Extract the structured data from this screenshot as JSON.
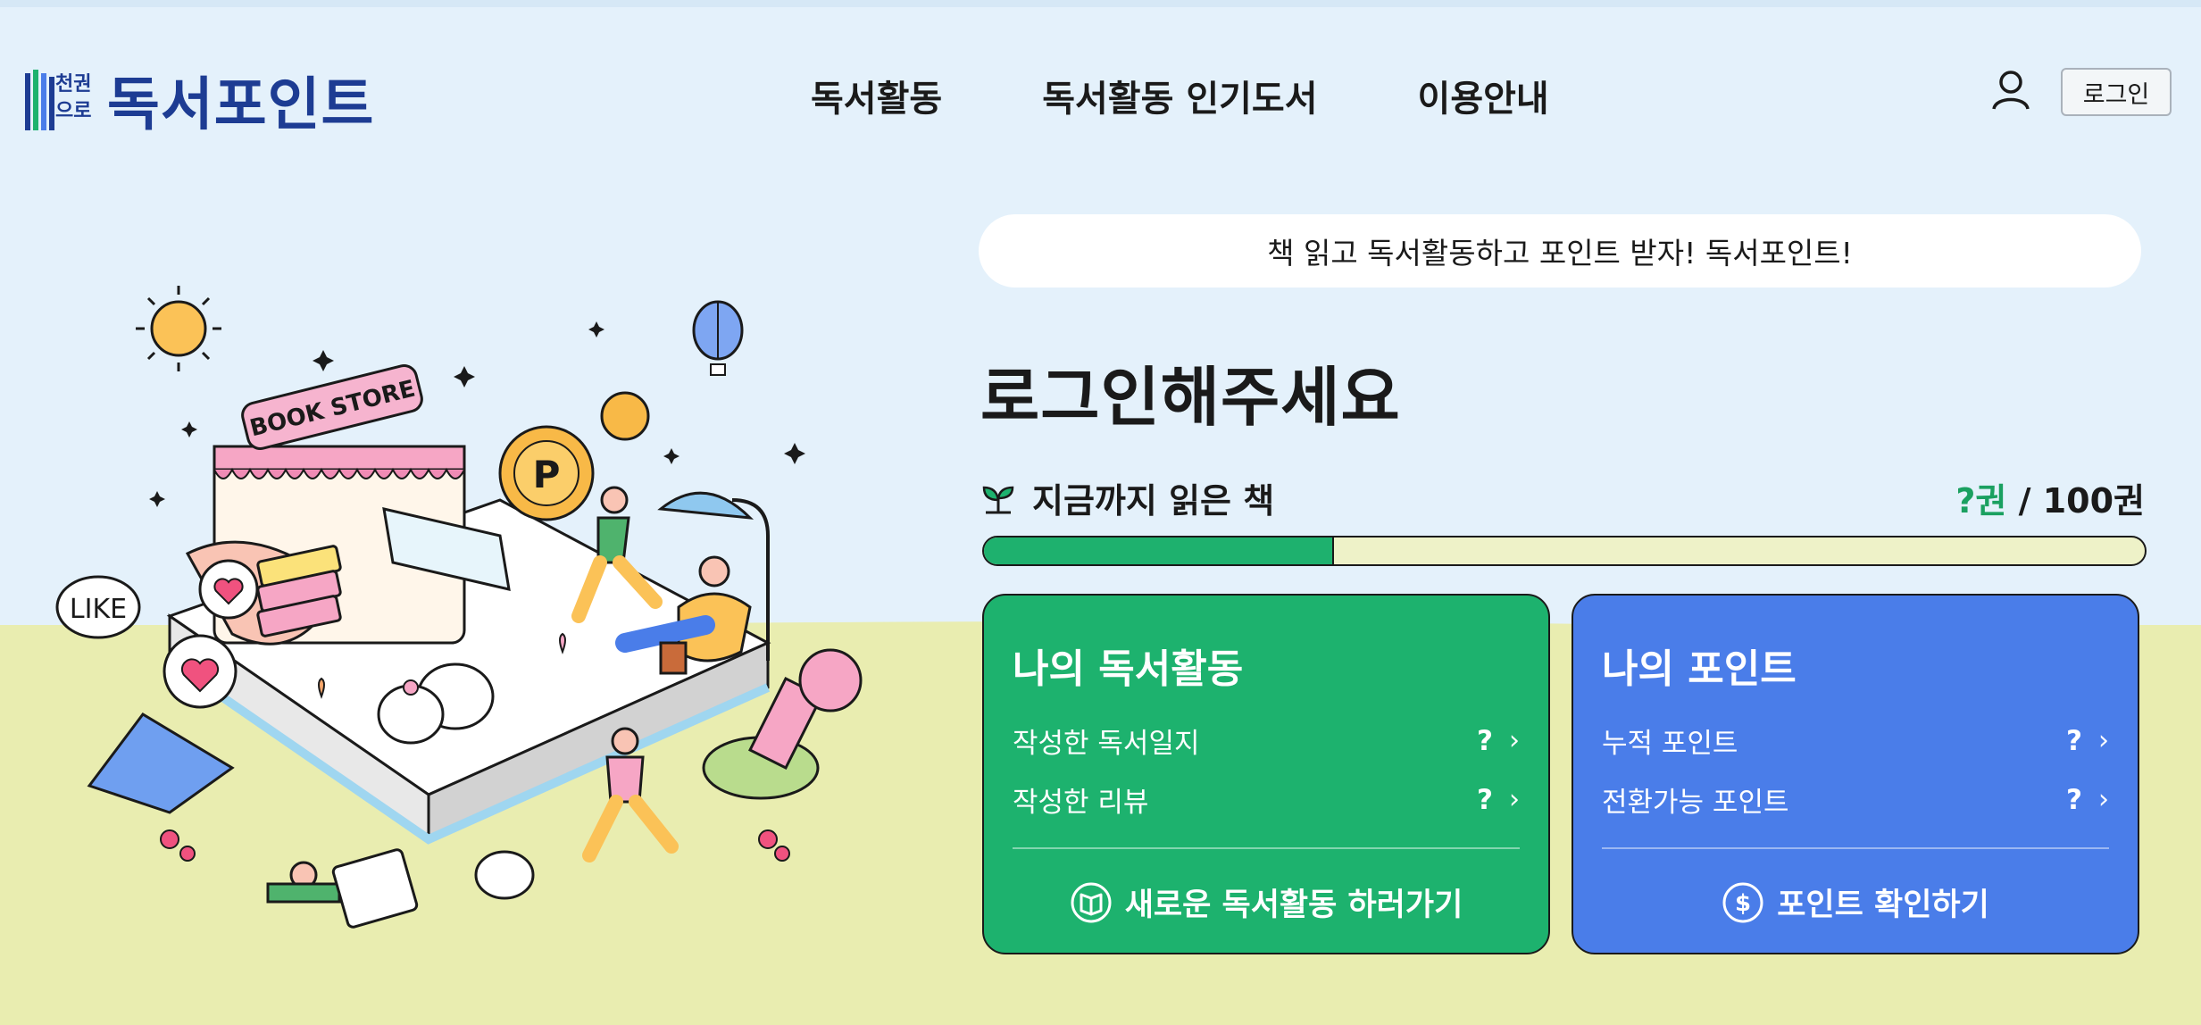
{
  "header": {
    "logo_small": "천권으로",
    "logo_text": "독서포인트",
    "nav": [
      "독서활동",
      "독서활동 인기도서",
      "이용안내"
    ],
    "login_label": "로그인",
    "user_icon": "user-icon"
  },
  "banner": {
    "text": "책 읽고 독서활동하고 포인트 받자! 독서포인트!"
  },
  "main": {
    "title": "로그인해주세요",
    "read_label": "지금까지 읽은 책",
    "read_current": "?권",
    "read_total": "/ 100권",
    "progress_fraction": 0.3
  },
  "cards": {
    "activity": {
      "title": "나의 독서활동",
      "rows": [
        {
          "label": "작성한 독서일지",
          "value": "?"
        },
        {
          "label": "작성한 리뷰",
          "value": "?"
        }
      ],
      "action": "새로운 독서활동 하러가기",
      "action_icon": "book-icon",
      "color": "#1db26e"
    },
    "points": {
      "title": "나의 포인트",
      "rows": [
        {
          "label": "누적 포인트",
          "value": "?"
        },
        {
          "label": "전환가능 포인트",
          "value": "?"
        }
      ],
      "action": "포인트 확인하기",
      "action_icon": "dollar-coin-icon",
      "color": "#4a7de9"
    }
  },
  "illustration": {
    "store_sign": "BOOK STORE",
    "bubble": "LIKE",
    "coin_letter": "P"
  }
}
